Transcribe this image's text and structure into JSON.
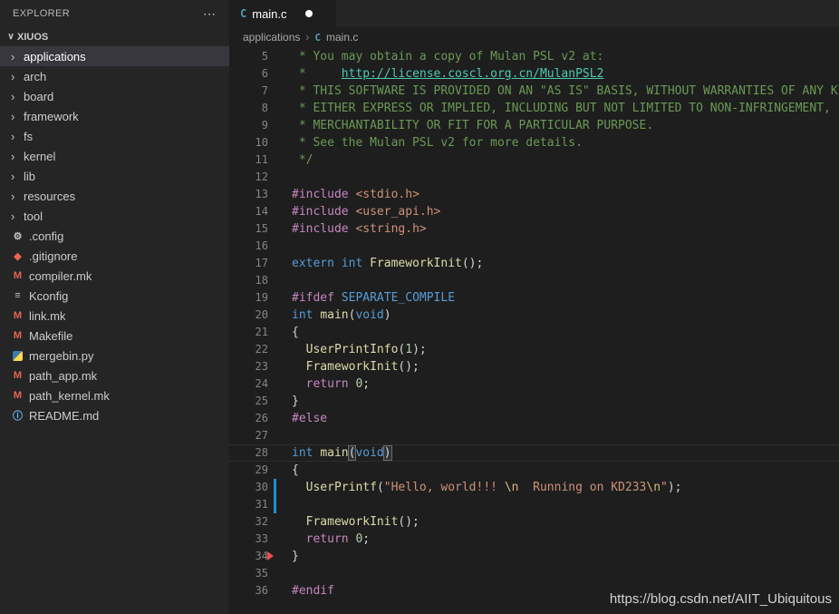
{
  "colors": {
    "sidebar_bg": "#252526",
    "editor_bg": "#1e1e1e",
    "selection_bg": "#37373d",
    "comment": "#6a9955",
    "link": "#4ec9b0",
    "pre": "#c586c0",
    "str": "#ce9178",
    "kw": "#569cd6",
    "fn": "#dcdcaa",
    "num": "#b5cea8",
    "ctrl": "#c586c0",
    "esc": "#d7ba7d",
    "def": "#d4d4d4",
    "ln": "#858585",
    "modified": "#2090d3",
    "deleted": "#f14c4c",
    "c_icon": "#519aba"
  },
  "sidebar": {
    "title": "EXPLORER",
    "more_label": "⋯",
    "workspace": "XIUOS",
    "workspace_chevron": "∨",
    "folder_chevron": "›",
    "selected": "applications",
    "folders": [
      "applications",
      "arch",
      "board",
      "framework",
      "fs",
      "kernel",
      "lib",
      "resources",
      "tool"
    ],
    "files": [
      {
        "name": ".config",
        "icon": "gear-icon",
        "glyph": "⚙",
        "color": "#c5c5c5"
      },
      {
        "name": ".gitignore",
        "icon": "git-icon",
        "glyph": "◆",
        "color": "#e8654f"
      },
      {
        "name": "compiler.mk",
        "icon": "makefile-icon",
        "glyph": "M",
        "color": "#e8654f"
      },
      {
        "name": "Kconfig",
        "icon": "config-icon",
        "glyph": "≡",
        "color": "#c5c5c5"
      },
      {
        "name": "link.mk",
        "icon": "makefile-icon",
        "glyph": "M",
        "color": "#e8654f"
      },
      {
        "name": "Makefile",
        "icon": "makefile-icon",
        "glyph": "M",
        "color": "#e8654f"
      },
      {
        "name": "mergebin.py",
        "icon": "python-icon",
        "glyph": "",
        "color": ""
      },
      {
        "name": "path_app.mk",
        "icon": "makefile-icon",
        "glyph": "M",
        "color": "#e8654f"
      },
      {
        "name": "path_kernel.mk",
        "icon": "makefile-icon",
        "glyph": "M",
        "color": "#e8654f"
      },
      {
        "name": "README.md",
        "icon": "info-icon",
        "glyph": "ⓘ",
        "color": "#75beff"
      }
    ]
  },
  "tabs": [
    {
      "label": "main.c",
      "icon_glyph": "C",
      "modified": true
    }
  ],
  "breadcrumb": {
    "folder": "applications",
    "separator": "›",
    "file_icon_glyph": "C",
    "file": "main.c"
  },
  "editor": {
    "lines": [
      {
        "n": 5,
        "tokens": [
          {
            "t": " * You may obtain a copy of Mulan PSL v2 at:",
            "c": "comment"
          }
        ]
      },
      {
        "n": 6,
        "tokens": [
          {
            "t": " *     ",
            "c": "comment"
          },
          {
            "t": "http://license.coscl.org.cn/MulanPSL2",
            "c": "link"
          }
        ]
      },
      {
        "n": 7,
        "tokens": [
          {
            "t": " * THIS SOFTWARE IS PROVIDED ON AN \"AS IS\" BASIS, WITHOUT WARRANTIES OF ANY KIND,",
            "c": "comment"
          }
        ]
      },
      {
        "n": 8,
        "tokens": [
          {
            "t": " * EITHER EXPRESS OR IMPLIED, INCLUDING BUT NOT LIMITED TO NON-INFRINGEMENT,",
            "c": "comment"
          }
        ]
      },
      {
        "n": 9,
        "tokens": [
          {
            "t": " * MERCHANTABILITY OR FIT FOR A PARTICULAR PURPOSE.",
            "c": "comment"
          }
        ]
      },
      {
        "n": 10,
        "tokens": [
          {
            "t": " * See the Mulan PSL v2 for more details.",
            "c": "comment"
          }
        ]
      },
      {
        "n": 11,
        "tokens": [
          {
            "t": " */",
            "c": "comment"
          }
        ]
      },
      {
        "n": 12,
        "tokens": []
      },
      {
        "n": 13,
        "tokens": [
          {
            "t": "#include ",
            "c": "pre"
          },
          {
            "t": "<stdio.h>",
            "c": "str"
          }
        ]
      },
      {
        "n": 14,
        "tokens": [
          {
            "t": "#include ",
            "c": "pre"
          },
          {
            "t": "<user_api.h>",
            "c": "str"
          }
        ]
      },
      {
        "n": 15,
        "tokens": [
          {
            "t": "#include ",
            "c": "pre"
          },
          {
            "t": "<string.h>",
            "c": "str"
          }
        ]
      },
      {
        "n": 16,
        "tokens": []
      },
      {
        "n": 17,
        "tokens": [
          {
            "t": "extern",
            "c": "kw"
          },
          {
            "t": " ",
            "c": "def"
          },
          {
            "t": "int",
            "c": "kw"
          },
          {
            "t": " ",
            "c": "def"
          },
          {
            "t": "FrameworkInit",
            "c": "fn"
          },
          {
            "t": "();",
            "c": "def"
          }
        ]
      },
      {
        "n": 18,
        "tokens": []
      },
      {
        "n": 19,
        "tokens": [
          {
            "t": "#ifdef ",
            "c": "pre"
          },
          {
            "t": "SEPARATE_COMPILE",
            "c": "kw"
          }
        ]
      },
      {
        "n": 20,
        "tokens": [
          {
            "t": "int",
            "c": "kw"
          },
          {
            "t": " ",
            "c": "def"
          },
          {
            "t": "main",
            "c": "fn"
          },
          {
            "t": "(",
            "c": "def"
          },
          {
            "t": "void",
            "c": "kw"
          },
          {
            "t": ")",
            "c": "def"
          }
        ]
      },
      {
        "n": 21,
        "tokens": [
          {
            "t": "{",
            "c": "def"
          }
        ]
      },
      {
        "n": 22,
        "tokens": [
          {
            "t": "  ",
            "c": "def"
          },
          {
            "t": "UserPrintInfo",
            "c": "fn"
          },
          {
            "t": "(",
            "c": "def"
          },
          {
            "t": "1",
            "c": "num"
          },
          {
            "t": ");",
            "c": "def"
          }
        ]
      },
      {
        "n": 23,
        "tokens": [
          {
            "t": "  ",
            "c": "def"
          },
          {
            "t": "FrameworkInit",
            "c": "fn"
          },
          {
            "t": "();",
            "c": "def"
          }
        ]
      },
      {
        "n": 24,
        "tokens": [
          {
            "t": "  ",
            "c": "def"
          },
          {
            "t": "return",
            "c": "ctrl"
          },
          {
            "t": " ",
            "c": "def"
          },
          {
            "t": "0",
            "c": "num"
          },
          {
            "t": ";",
            "c": "def"
          }
        ]
      },
      {
        "n": 25,
        "tokens": [
          {
            "t": "}",
            "c": "def"
          }
        ]
      },
      {
        "n": 26,
        "tokens": [
          {
            "t": "#else",
            "c": "pre"
          }
        ]
      },
      {
        "n": 27,
        "tokens": []
      },
      {
        "n": 28,
        "current": true,
        "tokens": [
          {
            "t": "int",
            "c": "kw"
          },
          {
            "t": " ",
            "c": "def"
          },
          {
            "t": "main",
            "c": "fn"
          },
          {
            "t": "(",
            "c": "brhl"
          },
          {
            "t": "void",
            "c": "kw"
          },
          {
            "t": ")",
            "c": "brhl"
          }
        ]
      },
      {
        "n": 29,
        "tokens": [
          {
            "t": "{",
            "c": "def"
          }
        ]
      },
      {
        "n": 30,
        "gutter": "modified",
        "tokens": [
          {
            "t": "  ",
            "c": "def"
          },
          {
            "t": "UserPrintf",
            "c": "fn"
          },
          {
            "t": "(",
            "c": "def"
          },
          {
            "t": "\"Hello, world!!! ",
            "c": "str"
          },
          {
            "t": "\\n",
            "c": "esc"
          },
          {
            "t": "  Running on KD233",
            "c": "str"
          },
          {
            "t": "\\n",
            "c": "esc"
          },
          {
            "t": "\"",
            "c": "str"
          },
          {
            "t": ");",
            "c": "def"
          }
        ]
      },
      {
        "n": 31,
        "gutter": "modified",
        "tokens": []
      },
      {
        "n": 32,
        "tokens": [
          {
            "t": "  ",
            "c": "def"
          },
          {
            "t": "FrameworkInit",
            "c": "fn"
          },
          {
            "t": "();",
            "c": "def"
          }
        ]
      },
      {
        "n": 33,
        "tokens": [
          {
            "t": "  ",
            "c": "def"
          },
          {
            "t": "return",
            "c": "ctrl"
          },
          {
            "t": " ",
            "c": "def"
          },
          {
            "t": "0",
            "c": "num"
          },
          {
            "t": ";",
            "c": "def"
          }
        ]
      },
      {
        "n": 34,
        "gutter": "deleted",
        "tokens": [
          {
            "t": "}",
            "c": "def"
          }
        ]
      },
      {
        "n": 35,
        "tokens": []
      },
      {
        "n": 36,
        "tokens": [
          {
            "t": "#endif",
            "c": "pre"
          }
        ]
      }
    ]
  },
  "watermark": "https://blog.csdn.net/AIIT_Ubiquitous"
}
